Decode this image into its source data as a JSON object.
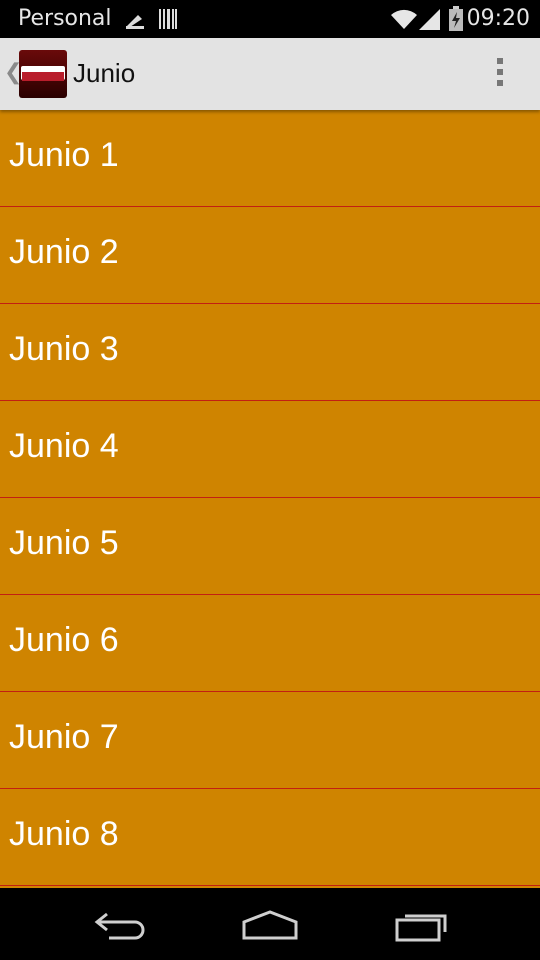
{
  "status_bar": {
    "carrier": "Personal",
    "time": "09:20"
  },
  "action_bar": {
    "title": "Junio",
    "logo_icon": "devocionales-cristianos-logo-icon",
    "up_icon": "chevron-left-icon",
    "overflow_icon": "more-vert-icon"
  },
  "list": {
    "items": [
      {
        "label": "Junio 1"
      },
      {
        "label": "Junio 2"
      },
      {
        "label": "Junio 3"
      },
      {
        "label": "Junio 4"
      },
      {
        "label": "Junio 5"
      },
      {
        "label": "Junio 6"
      },
      {
        "label": "Junio 7"
      },
      {
        "label": "Junio 8"
      }
    ]
  },
  "nav_bar": {
    "buttons": [
      "back-icon",
      "home-icon",
      "recents-icon"
    ]
  },
  "colors": {
    "list_bg": "#cf8400",
    "divider": "#c21f12",
    "action_bar_bg": "#e3e3e3"
  }
}
